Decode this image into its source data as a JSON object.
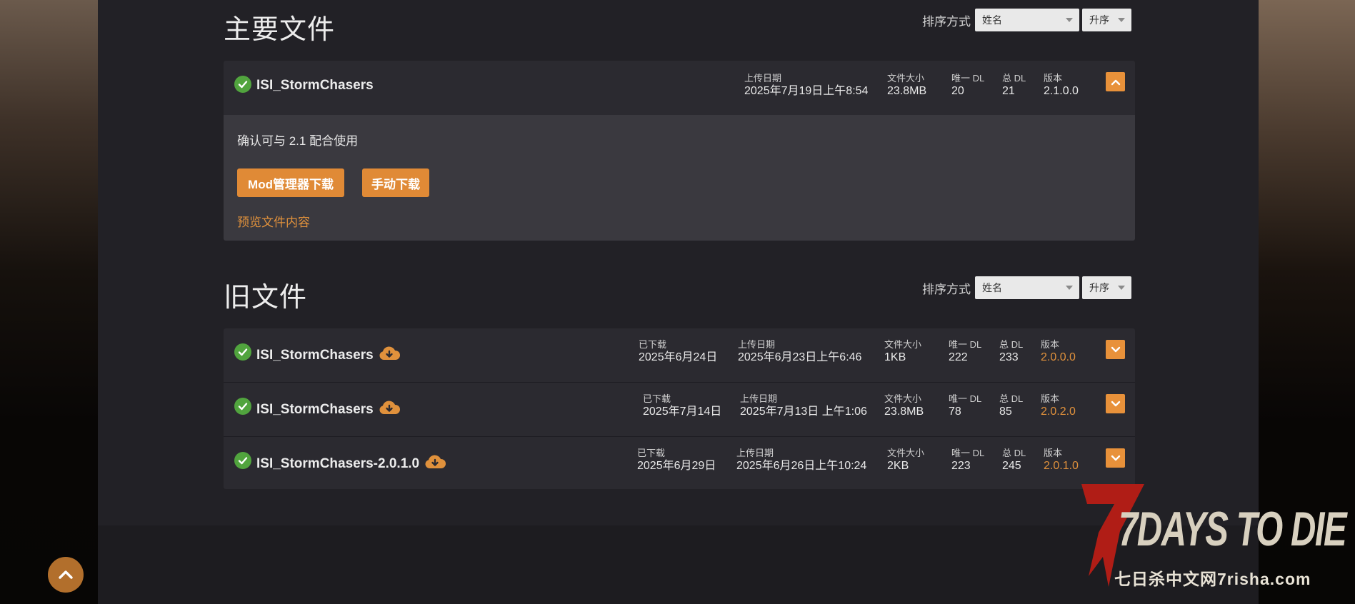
{
  "main_section": {
    "title": "主要文件",
    "sort_label": "排序方式",
    "sort_field": "姓名",
    "sort_order": "升序",
    "file": {
      "name": "ISI_StormChasers",
      "upload_label": "上传日期",
      "upload_value": "2025年7月19日上午8:54",
      "size_label": "文件大小",
      "size_value": "23.8MB",
      "unique_label": "唯一 DL",
      "unique_value": "20",
      "total_label": "总 DL",
      "total_value": "21",
      "version_label": "版本",
      "version_value": "2.1.0.0",
      "description": "确认可与 2.1 配合使用",
      "mod_manager_button": "Mod管理器下载",
      "manual_button": "手动下载",
      "preview_link": "预览文件内容"
    }
  },
  "old_section": {
    "title": "旧文件",
    "sort_label": "排序方式",
    "sort_field": "姓名",
    "sort_order": "升序",
    "files": [
      {
        "name": "ISI_StormChasers",
        "downloaded_label": "已下载",
        "downloaded_value": "2025年6月24日",
        "upload_label": "上传日期",
        "upload_value": "2025年6月23日上午6:46",
        "size_label": "文件大小",
        "size_value": "1KB",
        "unique_label": "唯一 DL",
        "unique_value": "222",
        "total_label": "总 DL",
        "total_value": "233",
        "version_label": "版本",
        "version_value": "2.0.0.0"
      },
      {
        "name": "ISI_StormChasers",
        "downloaded_label": "已下载",
        "downloaded_value": "2025年7月14日",
        "upload_label": "上传日期",
        "upload_value": "2025年7月13日 上午1:06",
        "size_label": "文件大小",
        "size_value": "23.8MB",
        "unique_label": "唯一 DL",
        "unique_value": "78",
        "total_label": "总 DL",
        "total_value": "85",
        "version_label": "版本",
        "version_value": "2.0.2.0"
      },
      {
        "name": "ISI_StormChasers-2.0.1.0",
        "downloaded_label": "已下载",
        "downloaded_value": "2025年6月29日",
        "upload_label": "上传日期",
        "upload_value": "2025年6月26日上午10:24",
        "size_label": "文件大小",
        "size_value": "2KB",
        "unique_label": "唯一 DL",
        "unique_value": "223",
        "total_label": "总 DL",
        "total_value": "245",
        "version_label": "版本",
        "version_value": "2.0.1.0"
      }
    ]
  },
  "logo": {
    "main": "7DAYS TO DIE",
    "sub": "七日杀中文网7risha.com"
  },
  "colors": {
    "accent": "#e08a36",
    "check": "#51a43e",
    "card": "#2b2a30",
    "page": "#222126"
  }
}
